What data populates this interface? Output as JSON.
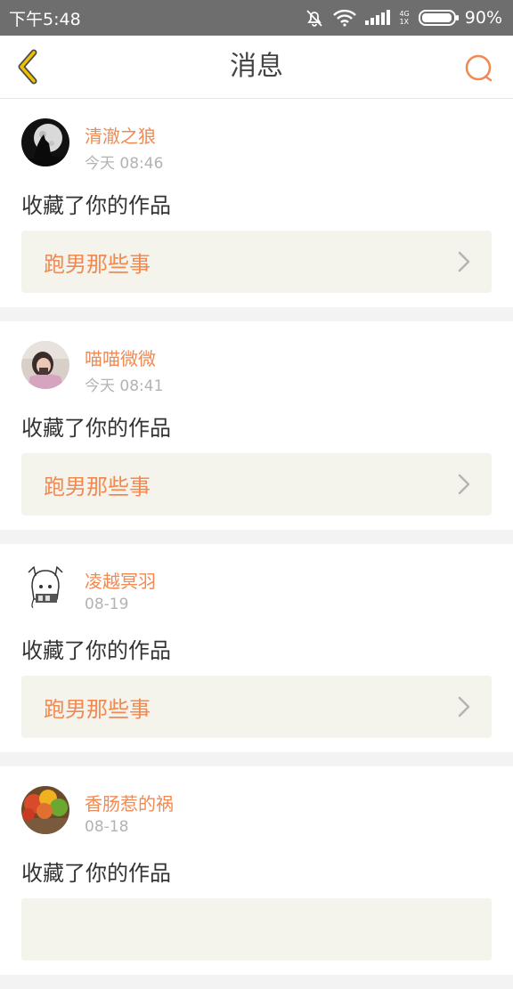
{
  "status_bar": {
    "time": "下午5:48",
    "network_top": "4G",
    "network_bottom": "1X",
    "battery": "90%",
    "icons": [
      "mute-icon",
      "wifi-icon",
      "signal-icon",
      "battery-icon"
    ]
  },
  "header": {
    "title": "消息",
    "back_icon": "chevron-left-icon",
    "search_icon": "search-icon",
    "accent_color": "#f08a52",
    "back_color": "#f0c000"
  },
  "messages": [
    {
      "username": "清澈之狼",
      "time": "今天 08:46",
      "action": "收藏了你的作品",
      "work": "跑男那些事",
      "avatar": "wolf-moon-avatar"
    },
    {
      "username": "喵喵微微",
      "time": "今天 08:41",
      "action": "收藏了你的作品",
      "work": "跑男那些事",
      "avatar": "girl-photo-avatar"
    },
    {
      "username": "凌越冥羽",
      "time": "08-19",
      "action": "收藏了你的作品",
      "work": "跑男那些事",
      "avatar": "anime-sketch-avatar"
    },
    {
      "username": "香肠惹的祸",
      "time": "08-18",
      "action": "收藏了你的作品",
      "work": "",
      "avatar": "autumn-leaves-avatar"
    }
  ]
}
